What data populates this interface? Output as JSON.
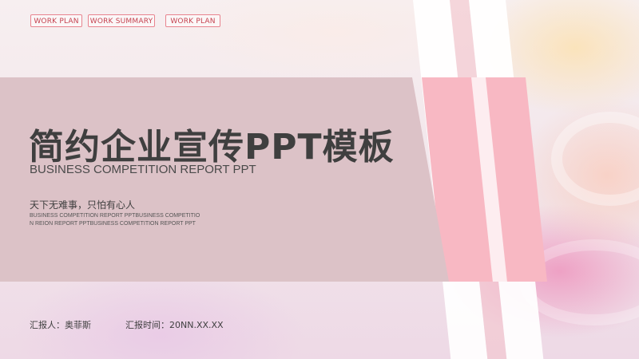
{
  "tags": [
    "WORK PLAN",
    "WORK SUMMARY",
    "WORK PLAN"
  ],
  "title": "简约企业宣传PPT模板",
  "subtitle": "BUSINESS COMPETITION REPORT PPT",
  "slogan": "天下无难事，只怕有心人",
  "description": "BUSINESS COMPETITION REPORT PPTBUSINESS COMPETITION REION REPORT PPTBUSINESS COMPETITION REPORT PPT",
  "footer": {
    "reporter": "汇报人：奥菲斯",
    "report_time": "汇报时间：20NN.XX.XX"
  },
  "colors": {
    "panel": "#dcc2c7",
    "accent_pink": "#f7b9c4",
    "tag_border": "#e8848f",
    "tag_text": "#c5424f",
    "text_dark": "#3f3f3f"
  }
}
